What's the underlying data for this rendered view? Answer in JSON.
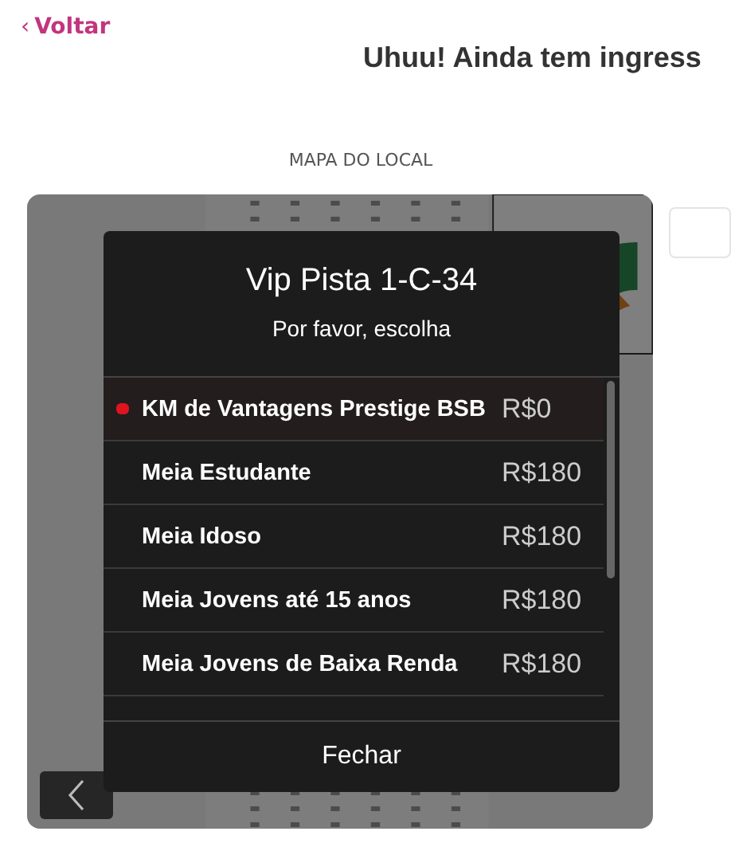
{
  "back_link": {
    "icon": "‹",
    "label": "Voltar"
  },
  "heading": "Uhuu! Ainda tem ingress",
  "map": {
    "label": "MAPA DO LOCAL"
  },
  "modal": {
    "title": "Vip Pista 1-C-34",
    "subtitle": "Por favor, escolha",
    "options": [
      {
        "name": "KM de Vantagens Prestige BSB",
        "price": "R$0",
        "selected": true
      },
      {
        "name": "Meia Estudante",
        "price": "R$180",
        "selected": false
      },
      {
        "name": "Meia Idoso",
        "price": "R$180",
        "selected": false
      },
      {
        "name": "Meia Jovens até 15 anos",
        "price": "R$180",
        "selected": false
      },
      {
        "name": "Meia Jovens de Baixa Renda",
        "price": "R$180",
        "selected": false
      }
    ],
    "close_button": "Fechar"
  }
}
